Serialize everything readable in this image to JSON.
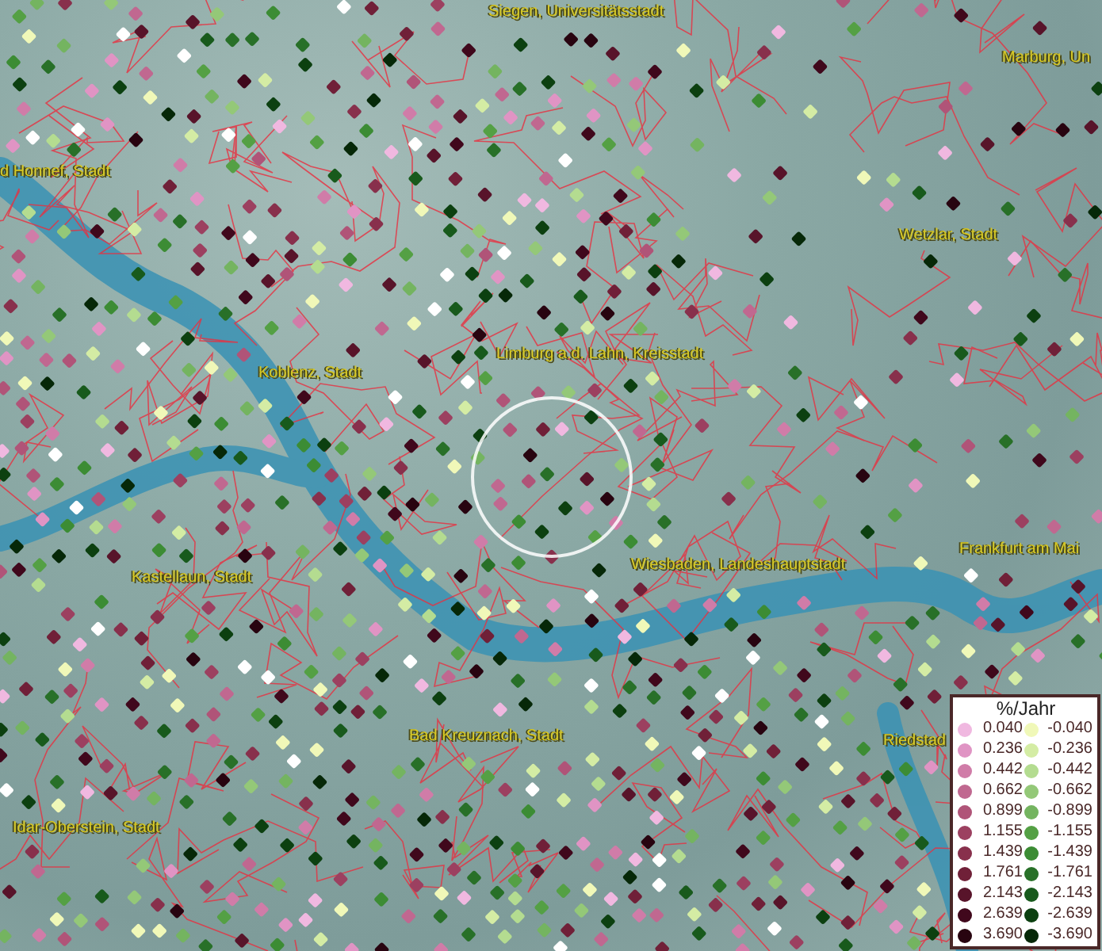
{
  "map": {
    "place_labels": [
      {
        "text": "Siegen, Universitätsstadt"
      },
      {
        "text": "Marburg, Un"
      },
      {
        "text": "d Honnef, Stadt"
      },
      {
        "text": "Wetzlar, Stadt"
      },
      {
        "text": "Limburg a.d. Lahn, Kreisstadt"
      },
      {
        "text": "Koblenz, Stadt"
      },
      {
        "text": "Wiesbaden, Landeshauptstadt"
      },
      {
        "text": "Frankfurt am Mai"
      },
      {
        "text": "Kastellaun, Stadt"
      },
      {
        "text": "Bad Kreuznach, Stadt"
      },
      {
        "text": "Riedstad"
      },
      {
        "text": "Idar-Oberstein, Stadt"
      }
    ]
  },
  "legend": {
    "title": "%/Jahr",
    "rows": [
      {
        "positive": {
          "label": "0.040",
          "color": "#f0b8e0"
        },
        "negative": {
          "label": "-0.040",
          "color": "#f0f8b8"
        }
      },
      {
        "positive": {
          "label": "0.236",
          "color": "#e094c4"
        },
        "negative": {
          "label": "-0.236",
          "color": "#d4eca4"
        }
      },
      {
        "positive": {
          "label": "0.442",
          "color": "#d07ca8"
        },
        "negative": {
          "label": "-0.442",
          "color": "#b4dc90"
        }
      },
      {
        "positive": {
          "label": "0.662",
          "color": "#c06890"
        },
        "negative": {
          "label": "-0.662",
          "color": "#94c878"
        }
      },
      {
        "positive": {
          "label": "0.899",
          "color": "#b05478"
        },
        "negative": {
          "label": "-0.899",
          "color": "#74b460"
        }
      },
      {
        "positive": {
          "label": "1.155",
          "color": "#9c4060"
        },
        "negative": {
          "label": "-1.155",
          "color": "#54a044"
        }
      },
      {
        "positive": {
          "label": "1.439",
          "color": "#88304c"
        },
        "negative": {
          "label": "-1.439",
          "color": "#3c8c34"
        }
      },
      {
        "positive": {
          "label": "1.761",
          "color": "#702038"
        },
        "negative": {
          "label": "-1.761",
          "color": "#287028"
        }
      },
      {
        "positive": {
          "label": "2.143",
          "color": "#58142a"
        },
        "negative": {
          "label": "-2.143",
          "color": "#185a1c"
        }
      },
      {
        "positive": {
          "label": "2.639",
          "color": "#40081c"
        },
        "negative": {
          "label": "-2.639",
          "color": "#0c4010"
        }
      },
      {
        "positive": {
          "label": "3.690",
          "color": "#280410"
        },
        "negative": {
          "label": "-3.690",
          "color": "#062808"
        }
      }
    ]
  }
}
